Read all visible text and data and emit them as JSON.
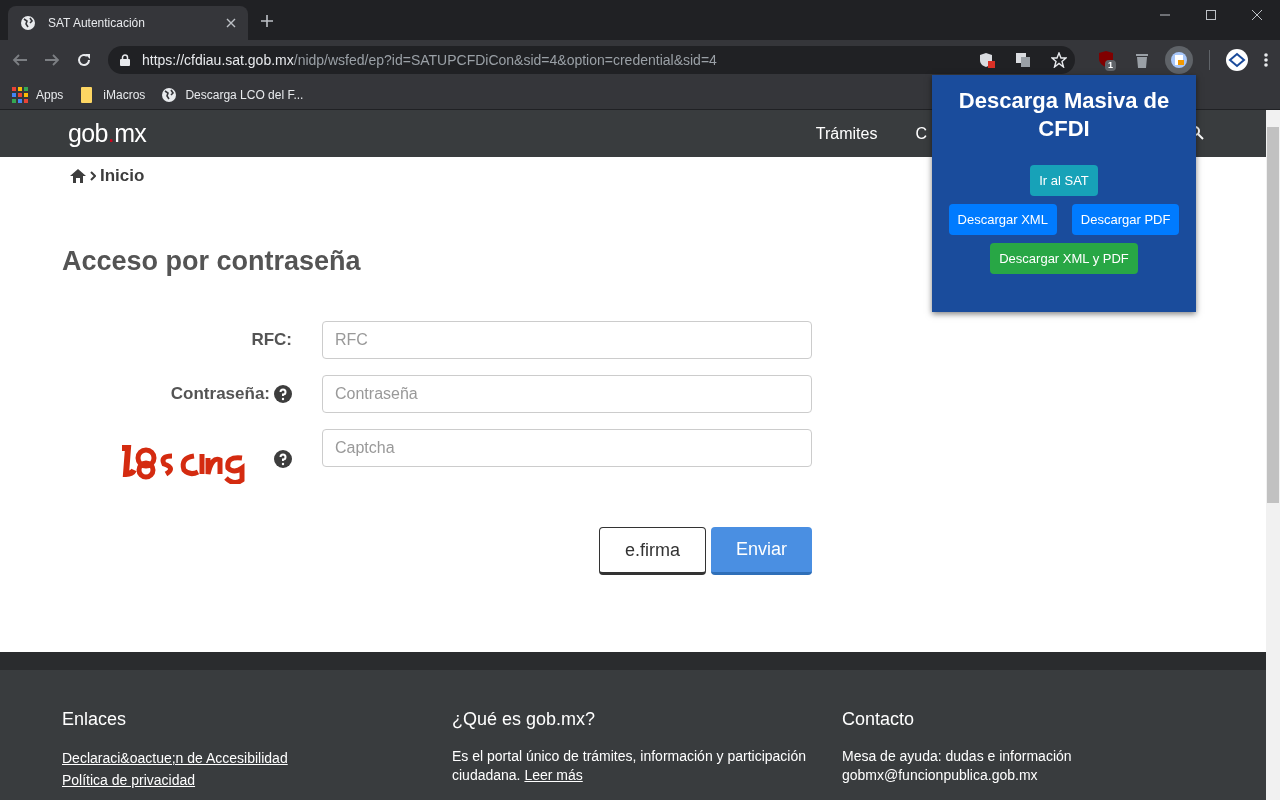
{
  "browser": {
    "tab": {
      "title": "SAT Autenticación",
      "selected": true
    },
    "url": {
      "host": "https://cfdiau.sat.gob.mx",
      "path": "/nidp/wsfed/ep?id=SATUPCFDiCon&sid=4&option=credential&sid=4"
    },
    "extension_badge": "1",
    "bookmarks": [
      {
        "label": "Apps",
        "kind": "apps"
      },
      {
        "label": "iMacros",
        "kind": "folder"
      },
      {
        "label": "Descarga LCO del F...",
        "kind": "globe"
      }
    ]
  },
  "header": {
    "logo_left": "gob",
    "logo_dot": ".",
    "logo_right": "mx",
    "nav": [
      "Trámites",
      "C"
    ]
  },
  "breadcrumb": "Inicio",
  "heading": "Acceso por contraseña",
  "form": {
    "fields": [
      {
        "label": "RFC:",
        "placeholder": "RFC",
        "help": false
      },
      {
        "label": "Contraseña:",
        "placeholder": "Contraseña",
        "help": true
      },
      {
        "placeholder": "Captcha",
        "help": true,
        "kind": "captcha"
      }
    ],
    "buttons": [
      {
        "label": "e.firma",
        "kind": "secondary"
      },
      {
        "label": "Enviar",
        "kind": "primary"
      }
    ]
  },
  "footer": {
    "columns": [
      {
        "title": "Enlaces",
        "lines": [
          {
            "text": "Declaraci&oactue;n de Accesibilidad",
            "kind": "link"
          },
          {
            "text": "Política de privacidad",
            "kind": "link"
          }
        ]
      },
      {
        "title": "¿Qué es gob.mx?",
        "lines": [
          {
            "text": "Es el portal único de trámites, información y participación ciudadana.",
            "kind": "text",
            "link": "Leer más"
          }
        ]
      },
      {
        "title": "Contacto",
        "lines": [
          {
            "text": "Mesa de ayuda: dudas e información",
            "kind": "text"
          },
          {
            "text": "gobmx@funcionpublica.gob.mx",
            "kind": "text"
          }
        ]
      }
    ]
  },
  "popup": {
    "title": "Descarga Masiva de CFDI",
    "buttons": [
      {
        "label": "Ir al SAT",
        "color": "#17a2b8"
      },
      {
        "label": "Descargar XML",
        "color": "#007bff"
      },
      {
        "label": "Descargar PDF",
        "color": "#007bff"
      },
      {
        "label": "Descargar XML y PDF",
        "color": "#28a745"
      }
    ]
  }
}
